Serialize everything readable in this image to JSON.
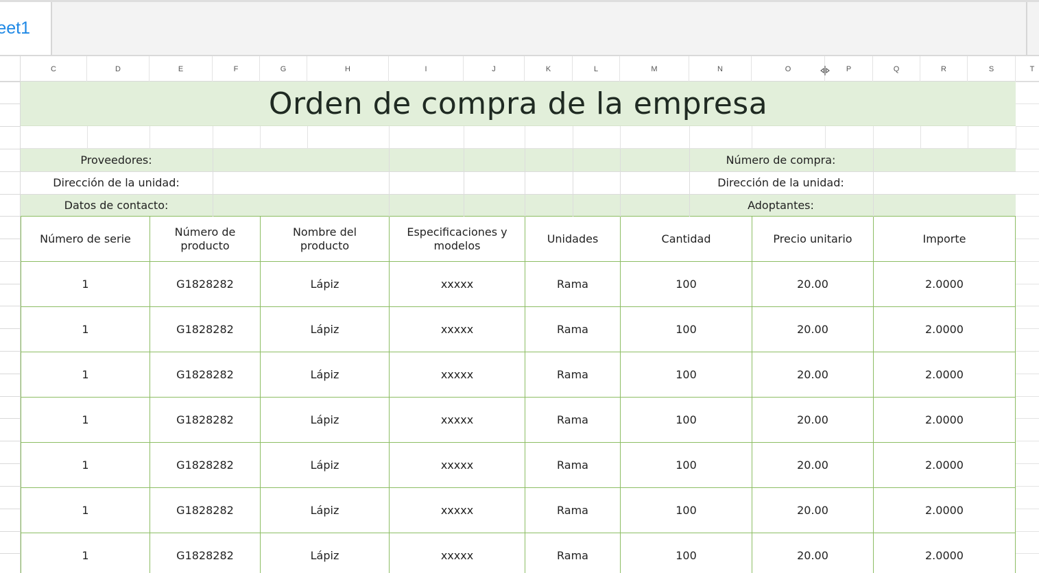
{
  "sheet_tab": {
    "label": "eet1"
  },
  "columns": [
    "C",
    "D",
    "E",
    "F",
    "G",
    "H",
    "I",
    "J",
    "K",
    "L",
    "M",
    "N",
    "O",
    "P",
    "Q",
    "R",
    "S",
    "T"
  ],
  "title": "Orden de compra de la empresa",
  "info": {
    "proveedores": "Proveedores:",
    "numero_compra": "Número de compra:",
    "direccion_left": "Dirección de la unidad:",
    "direccion_right": "Dirección de la unidad:",
    "datos_contacto": "Datos de contacto:",
    "adoptantes": "Adoptantes:"
  },
  "table": {
    "headers": [
      "Número de serie",
      "Número de producto",
      "Nombre del producto",
      "Especificaciones y modelos",
      "Unidades",
      "Cantidad",
      "Precio unitario",
      "Importe"
    ],
    "rows": [
      [
        "1",
        "G1828282",
        "Lápiz",
        "xxxxx",
        "Rama",
        "100",
        "20.00",
        "2.0000"
      ],
      [
        "1",
        "G1828282",
        "Lápiz",
        "xxxxx",
        "Rama",
        "100",
        "20.00",
        "2.0000"
      ],
      [
        "1",
        "G1828282",
        "Lápiz",
        "xxxxx",
        "Rama",
        "100",
        "20.00",
        "2.0000"
      ],
      [
        "1",
        "G1828282",
        "Lápiz",
        "xxxxx",
        "Rama",
        "100",
        "20.00",
        "2.0000"
      ],
      [
        "1",
        "G1828282",
        "Lápiz",
        "xxxxx",
        "Rama",
        "100",
        "20.00",
        "2.0000"
      ],
      [
        "1",
        "G1828282",
        "Lápiz",
        "xxxxx",
        "Rama",
        "100",
        "20.00",
        "2.0000"
      ],
      [
        "1",
        "G1828282",
        "Lápiz",
        "xxxxx",
        "Rama",
        "100",
        "20.00",
        "2.0000"
      ]
    ]
  },
  "colors": {
    "green_fill": "#e2efda",
    "table_border": "#8cbd63",
    "tab_text": "#1e88e5"
  }
}
